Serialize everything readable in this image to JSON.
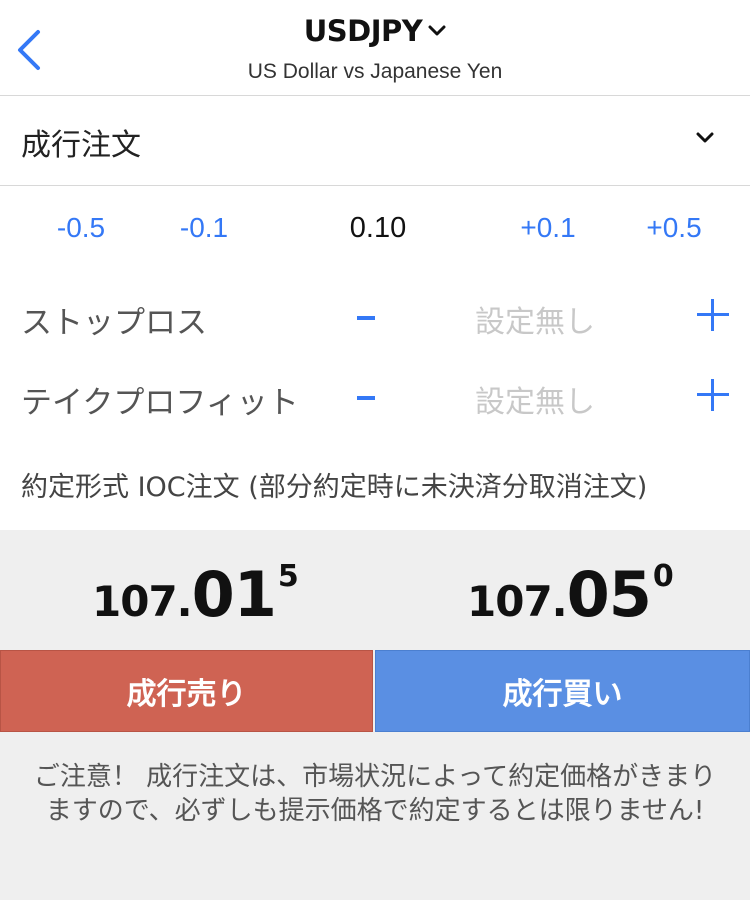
{
  "header": {
    "symbol": "USDJPY",
    "subtitle": "US Dollar vs Japanese Yen"
  },
  "order_type": {
    "label": "成行注文"
  },
  "volume": {
    "decrease_large": "-0.5",
    "decrease_small": "-0.1",
    "value": "0.10",
    "increase_small": "+0.1",
    "increase_large": "+0.5"
  },
  "stop_loss": {
    "label": "ストップロス",
    "value": "設定無し"
  },
  "take_profit": {
    "label": "テイクプロフィット",
    "value": "設定無し"
  },
  "fill_policy": "約定形式 IOC注文 (部分約定時に未決済分取消注文)",
  "prices": {
    "bid": {
      "prefix": "107.",
      "big": "01",
      "sup": "5"
    },
    "ask": {
      "prefix": "107.",
      "big": "05",
      "sup": "0"
    }
  },
  "buttons": {
    "sell": "成行売り",
    "buy": "成行買い"
  },
  "notice": "ご注意！ 成行注文は、市場状況によって約定価格がきまりますので、必ずしも提示価格で約定するとは限りません!",
  "colors": {
    "accent": "#3478f6",
    "sell": "#cf6353",
    "buy": "#5a8fe3"
  }
}
